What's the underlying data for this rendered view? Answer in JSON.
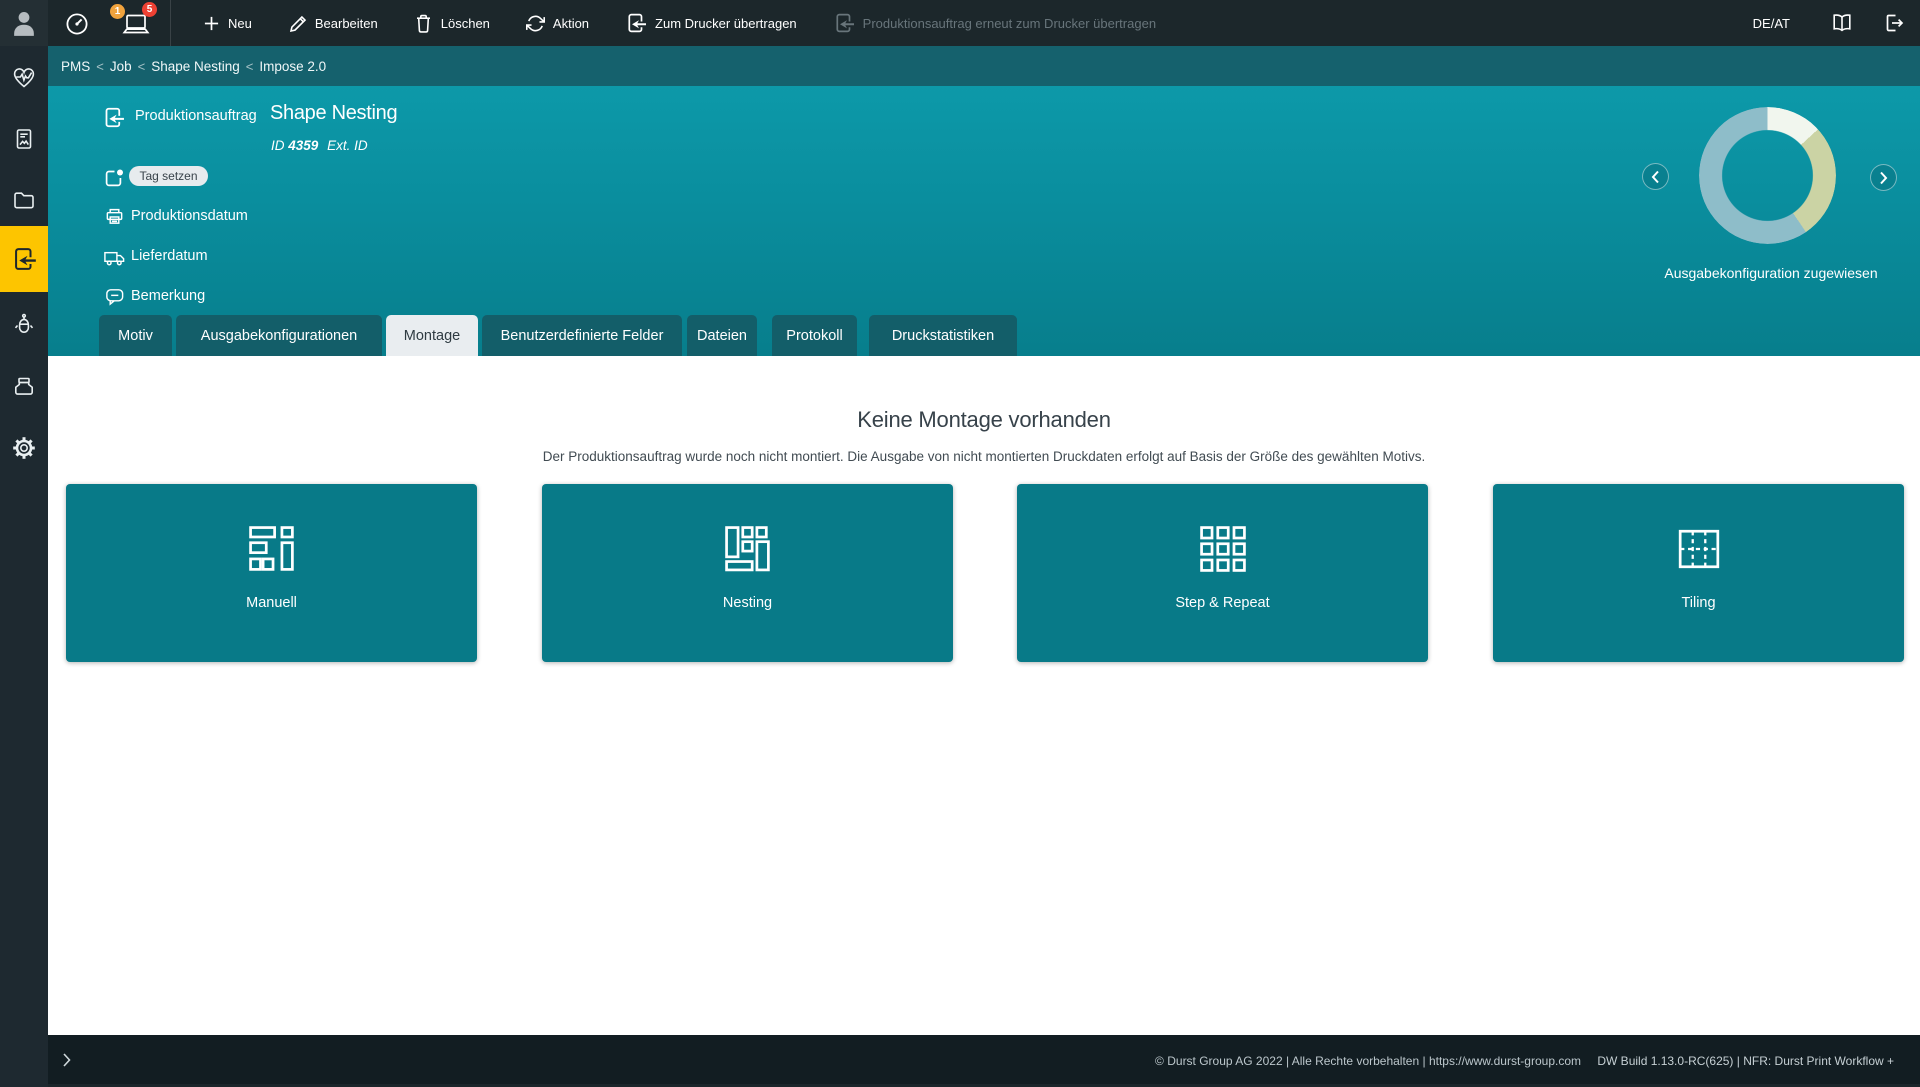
{
  "topbar": {
    "badge_warning": "1",
    "badge_error": "5",
    "actions": {
      "neu": "Neu",
      "bearbeiten": "Bearbeiten",
      "loeschen": "Löschen",
      "aktion": "Aktion",
      "zum_drucker": "Zum Drucker übertragen",
      "erneut": "Produktionsauftrag erneut zum Drucker übertragen"
    },
    "locale": "DE/AT"
  },
  "sidebar": {
    "active_item": "production-orders",
    "active_color": "#fdc500"
  },
  "breadcrumb": {
    "separator": "<",
    "items": [
      "PMS",
      "Job",
      "Shape Nesting",
      "Impose 2.0"
    ]
  },
  "hero": {
    "type_label": "Produktionsauftrag",
    "title": "Shape Nesting",
    "id_label": "ID",
    "id_value": "4359",
    "ext_id_label": "Ext. ID",
    "tag_button": "Tag setzen",
    "production_date_label": "Produktionsdatum",
    "delivery_date_label": "Lieferdatum",
    "remark_label": "Bemerkung",
    "carousel_caption": "Ausgabekonfiguration zugewiesen"
  },
  "chart_data": {
    "type": "pie",
    "donut": true,
    "title": "Ausgabekonfiguration zugewiesen",
    "values": [
      13.2,
      27.3,
      59.5
    ],
    "colors": [
      "#f1f6ee",
      "#cbd3a4",
      "#8ebdc9"
    ],
    "legend": "none"
  },
  "tabs": {
    "active": "Montage",
    "items": [
      "Motiv",
      "Ausgabekonfigurationen",
      "Montage",
      "Benutzerdefinierte Felder",
      "Dateien",
      "Protokoll",
      "Druckstatistiken"
    ]
  },
  "empty_state": {
    "title": "Keine Montage vorhanden",
    "description": "Der Produktionsauftrag wurde noch nicht montiert. Die Ausgabe von nicht montierten Druckdaten erfolgt auf Basis der Größe des gewählten Motivs."
  },
  "montage_actions": [
    "Manuell",
    "Nesting",
    "Step & Repeat",
    "Tiling"
  ],
  "footer": {
    "copyright": "© Durst Group AG 2022 | Alle Rechte vorbehalten | https://www.durst-group.com",
    "build": "DW Build 1.13.0-RC(625)  |  NFR: Durst Print Workflow +"
  }
}
